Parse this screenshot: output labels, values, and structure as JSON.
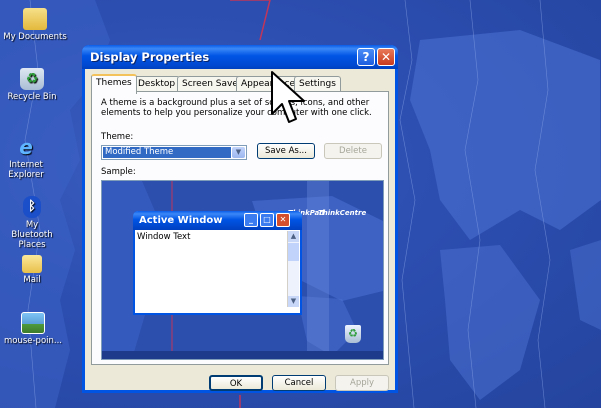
{
  "desktop": {
    "icons": [
      {
        "label": "My Documents",
        "icon": "my-documents-icon"
      },
      {
        "label": "Recycle Bin",
        "icon": "recycle-bin-icon"
      },
      {
        "label": "Internet Explorer",
        "icon": "internet-explorer-icon"
      },
      {
        "label": "My Bluetooth Places",
        "icon": "bluetooth-icon"
      },
      {
        "label": "Mail",
        "icon": "folder-icon"
      },
      {
        "label": "mouse-poin...",
        "icon": "image-file-icon"
      }
    ]
  },
  "window": {
    "title": "Display Properties",
    "help_glyph": "?",
    "close_glyph": "✕",
    "tabs": [
      "Themes",
      "Desktop",
      "Screen Saver",
      "Appearance",
      "Settings"
    ],
    "active_tab": "Themes",
    "description": "A theme is a background plus a set of sounds, icons, and other elements to help you personalize your computer with one click.",
    "theme_label": "Theme:",
    "theme_value": "Modified Theme",
    "save_as_label": "Save As...",
    "delete_label": "Delete",
    "sample_label": "Sample:",
    "sample": {
      "window_title": "Active Window",
      "window_text": "Window Text",
      "brand_left": "ThinkPad",
      "brand_right": "ThinkCentre"
    },
    "ok_label": "OK",
    "cancel_label": "Cancel",
    "apply_label": "Apply"
  },
  "colors": {
    "desktop_bg": "#2d4fb2",
    "titlebar": "#0055e5",
    "selection": "#316ac5",
    "tab_highlight": "#f4c25b"
  }
}
